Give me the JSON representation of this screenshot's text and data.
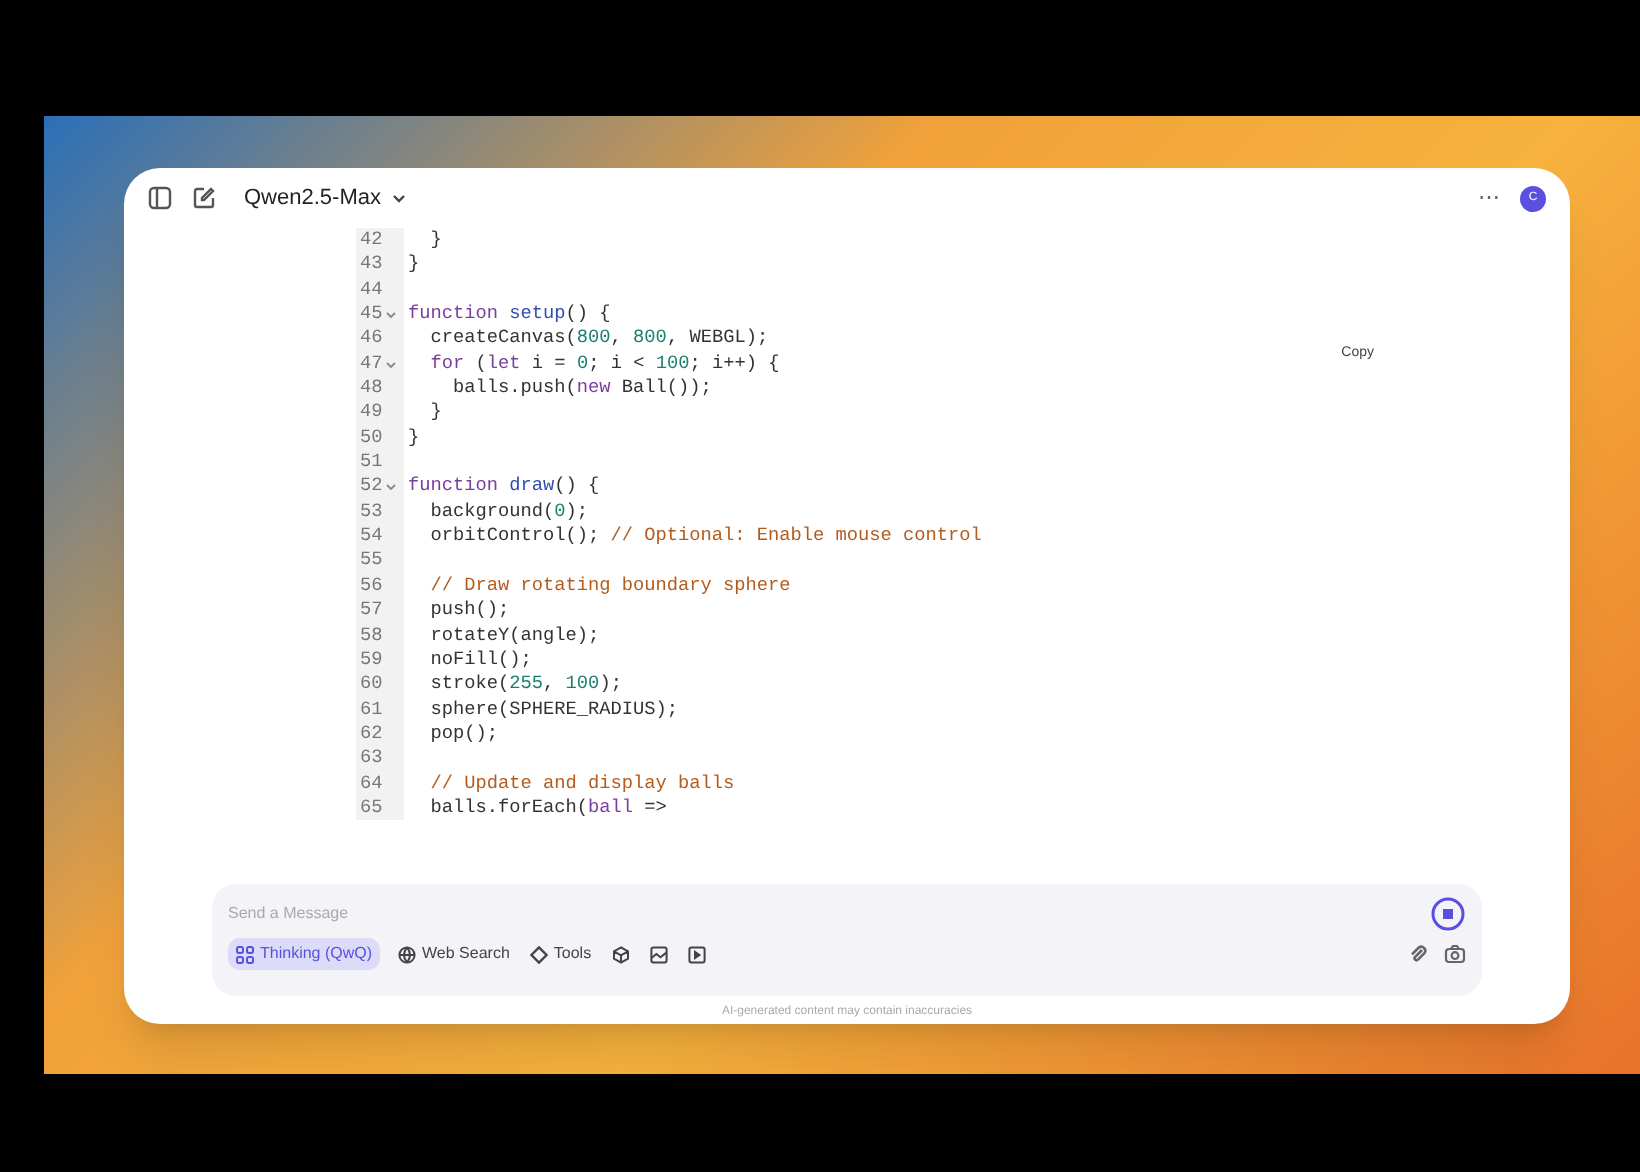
{
  "header": {
    "model": "Qwen2.5-Max",
    "more": "⋯",
    "avatar": "C"
  },
  "code": {
    "copy_label": "Copy",
    "lines": [
      {
        "n": "42",
        "fold": false,
        "seg": [
          {
            "kind": "plain",
            "t": "  }"
          }
        ]
      },
      {
        "n": "43",
        "fold": false,
        "seg": [
          {
            "kind": "plain",
            "t": "}"
          }
        ]
      },
      {
        "n": "44",
        "fold": false
      },
      {
        "n": "45",
        "fold": true,
        "seg": [
          {
            "kind": "keyword",
            "t": "function "
          },
          {
            "kind": "fn",
            "t": "setup"
          },
          {
            "kind": "plain",
            "t": "() {"
          }
        ]
      },
      {
        "n": "46",
        "fold": false,
        "seg": [
          {
            "kind": "plain",
            "t": "  createCanvas("
          },
          {
            "kind": "number",
            "t": "800"
          },
          {
            "kind": "plain",
            "t": ", "
          },
          {
            "kind": "number",
            "t": "800"
          },
          {
            "kind": "plain",
            "t": ", WEBGL);"
          }
        ]
      },
      {
        "n": "47",
        "fold": true,
        "seg": [
          {
            "kind": "keyword",
            "t": "  for"
          },
          {
            "kind": "plain",
            "t": " ("
          },
          {
            "kind": "keyword",
            "t": "let"
          },
          {
            "kind": "plain",
            "t": " i = "
          },
          {
            "kind": "number",
            "t": "0"
          },
          {
            "kind": "plain",
            "t": "; i < "
          },
          {
            "kind": "number",
            "t": "100"
          },
          {
            "kind": "plain",
            "t": "; i++) {"
          }
        ]
      },
      {
        "n": "48",
        "fold": false,
        "seg": [
          {
            "kind": "plain",
            "t": "    balls.push("
          },
          {
            "kind": "keyword",
            "t": "new"
          },
          {
            "kind": "plain",
            "t": " Ball());"
          }
        ]
      },
      {
        "n": "49",
        "fold": false,
        "seg": [
          {
            "kind": "plain",
            "t": "  }"
          }
        ]
      },
      {
        "n": "50",
        "fold": false,
        "seg": [
          {
            "kind": "plain",
            "t": "}"
          }
        ]
      },
      {
        "n": "51",
        "fold": false
      },
      {
        "n": "52",
        "fold": true,
        "seg": [
          {
            "kind": "keyword",
            "t": "function "
          },
          {
            "kind": "fn",
            "t": "draw"
          },
          {
            "kind": "plain",
            "t": "() {"
          }
        ]
      },
      {
        "n": "53",
        "fold": false,
        "seg": [
          {
            "kind": "plain",
            "t": "  background("
          },
          {
            "kind": "number",
            "t": "0"
          },
          {
            "kind": "plain",
            "t": ");"
          }
        ]
      },
      {
        "n": "54",
        "fold": false,
        "seg": [
          {
            "kind": "plain",
            "t": "  orbitControl(); "
          },
          {
            "kind": "comment",
            "t": "// Optional: Enable mouse control"
          }
        ]
      },
      {
        "n": "55",
        "fold": false
      },
      {
        "n": "56",
        "fold": false,
        "seg": [
          {
            "kind": "comment",
            "t": "  // Draw rotating boundary sphere"
          }
        ]
      },
      {
        "n": "57",
        "fold": false,
        "seg": [
          {
            "kind": "plain",
            "t": "  push();"
          }
        ]
      },
      {
        "n": "58",
        "fold": false,
        "seg": [
          {
            "kind": "plain",
            "t": "  rotateY(angle);"
          }
        ]
      },
      {
        "n": "59",
        "fold": false,
        "seg": [
          {
            "kind": "plain",
            "t": "  noFill();"
          }
        ]
      },
      {
        "n": "60",
        "fold": false,
        "seg": [
          {
            "kind": "plain",
            "t": "  stroke("
          },
          {
            "kind": "number",
            "t": "255"
          },
          {
            "kind": "plain",
            "t": ", "
          },
          {
            "kind": "number",
            "t": "100"
          },
          {
            "kind": "plain",
            "t": ");"
          }
        ]
      },
      {
        "n": "61",
        "fold": false,
        "seg": [
          {
            "kind": "plain",
            "t": "  sphere(SPHERE_RADIUS);"
          }
        ]
      },
      {
        "n": "62",
        "fold": false,
        "seg": [
          {
            "kind": "plain",
            "t": "  pop();"
          }
        ]
      },
      {
        "n": "63",
        "fold": false
      },
      {
        "n": "64",
        "fold": false,
        "seg": [
          {
            "kind": "comment",
            "t": "  // Update and display balls"
          }
        ]
      },
      {
        "n": "65",
        "fold": false,
        "seg": [
          {
            "kind": "plain",
            "t": "  balls.forEach("
          },
          {
            "kind": "keyword",
            "t": "ball"
          },
          {
            "kind": "plain",
            "t": " =>"
          }
        ]
      }
    ]
  },
  "composer": {
    "placeholder": "Send a Message",
    "tools": [
      {
        "kind": "thinking",
        "label": "Thinking (QwQ)",
        "selected": true
      },
      {
        "kind": "globe",
        "label": "Web Search",
        "selected": false
      },
      {
        "kind": "tools",
        "label": "Tools",
        "selected": false
      },
      {
        "kind": "cube",
        "selected": false
      },
      {
        "kind": "image",
        "selected": false
      },
      {
        "kind": "video",
        "selected": false
      }
    ]
  },
  "footer": "AI-generated content may contain inaccuracies"
}
